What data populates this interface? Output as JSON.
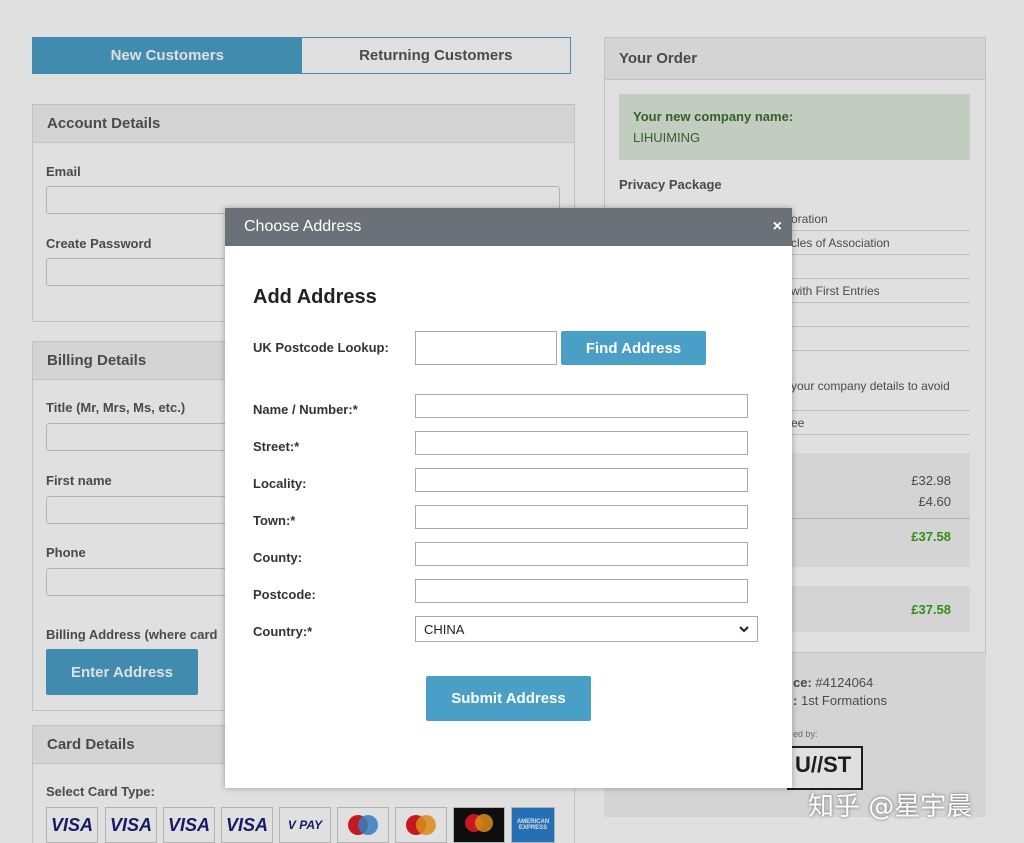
{
  "tabs": {
    "new_customers": "New Customers",
    "returning_customers": "Returning Customers"
  },
  "account": {
    "title": "Account Details",
    "email_label": "Email",
    "password_label": "Create Password"
  },
  "billing": {
    "title": "Billing Details",
    "title_label": "Title (Mr, Mrs, Ms, etc.)",
    "first_name_label": "First name",
    "phone_label": "Phone",
    "address_label": "Billing Address (where card",
    "enter_address_button": "Enter Address"
  },
  "card": {
    "title": "Card Details",
    "select_label": "Select Card Type:",
    "types": [
      "VISA",
      "VISA",
      "VISA",
      "VISA",
      "V PAY",
      "maestro",
      "mastercard",
      "mastercard",
      "AMERICAN EXPRESS"
    ]
  },
  "order": {
    "title": "Your Order",
    "company_label": "Your new company name:",
    "company_name": "LIHUIMING",
    "package": "Privacy Package",
    "rows": [
      "oration",
      "cles of Association",
      "",
      "with First Entries",
      "",
      "",
      "your company details to avoid",
      "ee"
    ],
    "price1": "£32.98",
    "price2": "£4.60",
    "subtotal": "£37.58",
    "total": "£37.58",
    "reference_label": "ce:",
    "reference": "#4124064",
    "formations_label": ":",
    "formations": "1st Formations",
    "powered_by": "ed by:",
    "logo": "U//ST"
  },
  "colors": {
    "accent": "#4a9fc7",
    "green": "#3aa020",
    "modal_header": "#6b7179"
  },
  "modal": {
    "title": "Choose Address",
    "close": "×",
    "heading": "Add Address",
    "postcode_lookup_label": "UK Postcode Lookup:",
    "find_button": "Find Address",
    "fields": {
      "name_number": "Name / Number:*",
      "street": "Street:*",
      "locality": "Locality:",
      "town": "Town:*",
      "county": "County:",
      "postcode": "Postcode:"
    },
    "country_label": "Country:*",
    "country_value": "CHINA",
    "submit_button": "Submit Address"
  },
  "watermark": "知乎 @星宇晨"
}
